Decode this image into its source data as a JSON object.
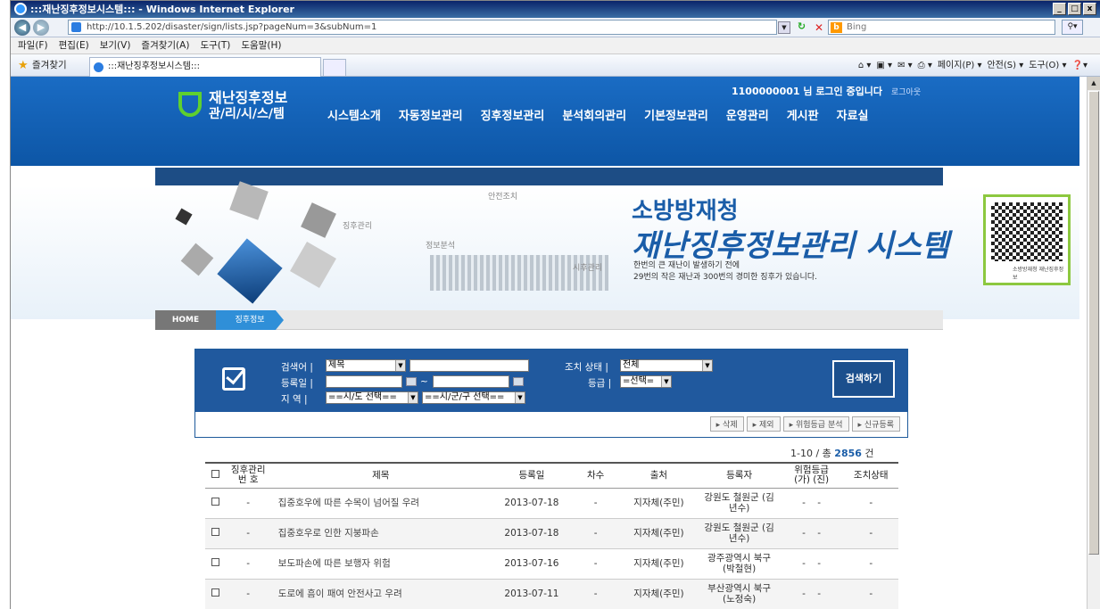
{
  "window": {
    "title": ":::재난징후정보시스템::: - Windows Internet Explorer",
    "controls": [
      "_",
      "□",
      "x"
    ]
  },
  "address": {
    "url": "http://10.1.5.202/disaster/sign/lists.jsp?pageNum=3&subNum=1",
    "search_engine": "Bing"
  },
  "menu": [
    "파일(F)",
    "편집(E)",
    "보기(V)",
    "즐겨찾기(A)",
    "도구(T)",
    "도움말(H)"
  ],
  "favorites": {
    "label": "즐겨찾기",
    "tab_title": ":::재난징후정보시스템:::",
    "commands": [
      "페이지(P) ▾",
      "안전(S) ▾",
      "도구(O) ▾"
    ]
  },
  "site": {
    "logo_line1": "재난징후정보",
    "logo_line2": "관/리/시/스/템",
    "login_text": "1100000001 님 로그인 중입니다",
    "logout": "로그아웃",
    "nav": [
      "시스템소개",
      "자동정보관리",
      "징후정보관리",
      "분석회의관리",
      "기본정보관리",
      "운영관리",
      "게시판",
      "자료실"
    ]
  },
  "banner": {
    "title1": "소방방재청",
    "title2": "재난징후정보관리 시스템",
    "sub1": "한번의 큰 재난이 발생하기 전에",
    "sub2": "29번의 작은 재난과 300번의 경미한 징후가 있습니다.",
    "labels": [
      "안전조치",
      "징후관리",
      "정보분석",
      "시후관리"
    ],
    "qr_label": "소방방재청 재난징후정보"
  },
  "breadcrumb": {
    "home": "HOME",
    "current": "징후정보"
  },
  "search": {
    "keyword_label": "검색어 |",
    "keyword_type": "제목",
    "status_label": "조치 상태 |",
    "status_value": "전체",
    "date_label": "등록일 |",
    "grade_label": "등급 |",
    "grade_value": "=선택=",
    "region_label": "지  역 |",
    "region1": "==시/도 선택==",
    "region2": "==시/군/구 선택==",
    "button": "검색하기",
    "tilde": "~"
  },
  "actions": [
    "▸ 삭제",
    "▸ 제외",
    "▸ 위험등급 분석",
    "▸ 신규등록"
  ],
  "paging": {
    "range": "1-10 / 총",
    "total": "2856",
    "unit": "건"
  },
  "table": {
    "headers": [
      "",
      "징후관리\n번 호",
      "제목",
      "등록일",
      "차수",
      "출처",
      "등록자",
      "위험등급\n(가) (진)",
      "조치상태"
    ],
    "rows": [
      {
        "no": "-",
        "title": "집중호우에 따른 수목이 넘어질 우려",
        "date": "2013-07-18",
        "round": "-",
        "source": "지자체(주민)",
        "author": "강원도 철원군 (김\n년수)",
        "grade": "-    -",
        "status": "-"
      },
      {
        "no": "-",
        "title": "집중호우로 인한 지붕파손",
        "date": "2013-07-18",
        "round": "-",
        "source": "지자체(주민)",
        "author": "강원도 철원군 (김\n년수)",
        "grade": "-    -",
        "status": "-"
      },
      {
        "no": "-",
        "title": "보도파손에 따른 보행자 위험",
        "date": "2013-07-16",
        "round": "-",
        "source": "지자체(주민)",
        "author": "광주광역시 북구\n(박철현)",
        "grade": "-    -",
        "status": "-"
      },
      {
        "no": "-",
        "title": "도로에 흠이 패여 안전사고 우려",
        "date": "2013-07-11",
        "round": "-",
        "source": "지자체(주민)",
        "author": "부산광역시 북구\n(노정숙)",
        "grade": "-    -",
        "status": "-"
      }
    ]
  },
  "colors": {
    "nav_blue": "#1a6cc4",
    "accent_green": "#5fd02f",
    "dark_blue": "#20599e"
  }
}
